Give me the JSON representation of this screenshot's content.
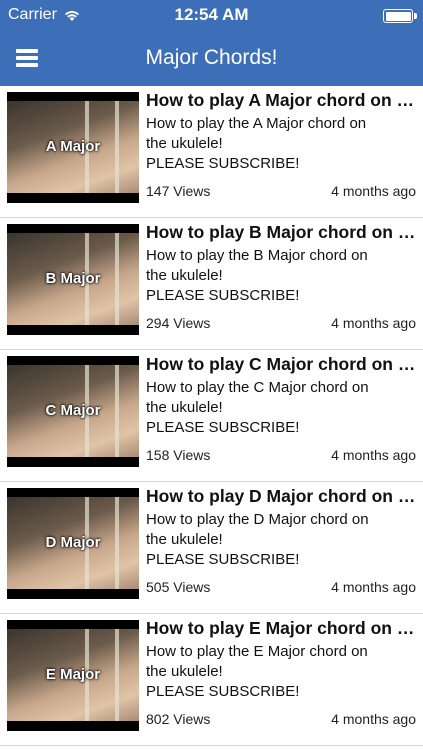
{
  "status_bar": {
    "carrier": "Carrier",
    "time": "12:54 AM"
  },
  "nav": {
    "title": "Major Chords!"
  },
  "videos": [
    {
      "thumb_label": "A Major",
      "title": "How to play A Major chord on the ukulele",
      "desc_line1": "How to play the A Major chord on the ukulele!",
      "desc_line2": "PLEASE SUBSCRIBE!",
      "views": "147 Views",
      "age": "4 months ago"
    },
    {
      "thumb_label": "B Major",
      "title": "How to play B Major chord on the ukulele",
      "desc_line1": "How to play the B Major chord on the ukulele!",
      "desc_line2": "PLEASE SUBSCRIBE!",
      "views": "294 Views",
      "age": "4 months ago"
    },
    {
      "thumb_label": "C Major",
      "title": "How to play C Major chord on the ukulele",
      "desc_line1": "How to play the C Major chord on the ukulele!",
      "desc_line2": "PLEASE SUBSCRIBE!",
      "views": "158 Views",
      "age": "4 months ago"
    },
    {
      "thumb_label": "D Major",
      "title": "How to play D Major chord on the ukulele",
      "desc_line1": "How to play the D Major chord on the ukulele!",
      "desc_line2": "PLEASE SUBSCRIBE!",
      "views": "505 Views",
      "age": "4 months ago"
    },
    {
      "thumb_label": "E Major",
      "title": "How to play E Major chord on the ukulele",
      "desc_line1": "How to play the E Major chord on the ukulele!",
      "desc_line2": "PLEASE SUBSCRIBE!",
      "views": "802 Views",
      "age": "4 months ago"
    }
  ],
  "colors": {
    "nav_background": "#3d6fb8",
    "nav_text": "#ffffff"
  }
}
